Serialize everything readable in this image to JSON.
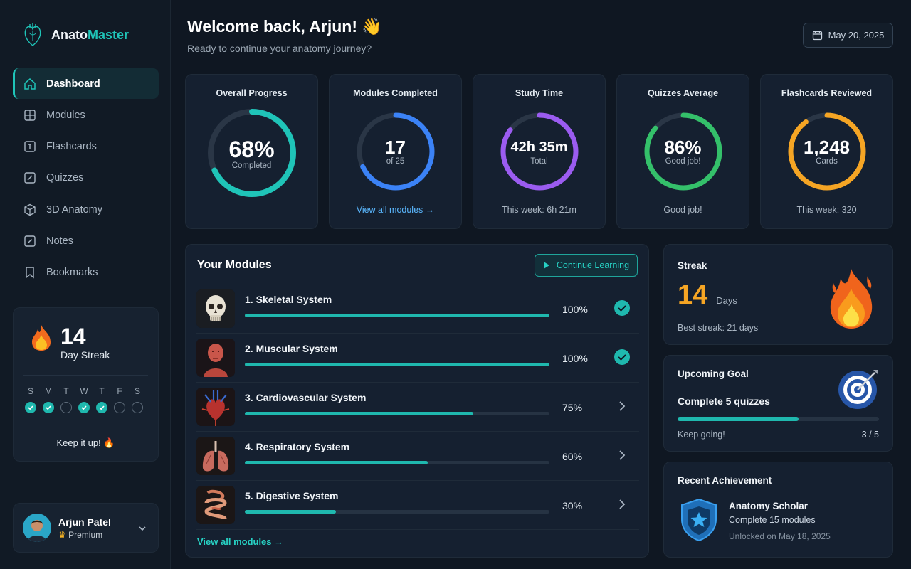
{
  "app": {
    "name_part1": "Anato",
    "name_part2": "Master"
  },
  "nav": [
    {
      "label": "Dashboard",
      "icon": "home-icon",
      "active": true
    },
    {
      "label": "Modules",
      "icon": "modules-icon"
    },
    {
      "label": "Flashcards",
      "icon": "flashcards-icon"
    },
    {
      "label": "Quizzes",
      "icon": "quizzes-icon"
    },
    {
      "label": "3D Anatomy",
      "icon": "cube-icon"
    },
    {
      "label": "Notes",
      "icon": "notes-icon"
    },
    {
      "label": "Bookmarks",
      "icon": "bookmark-icon"
    }
  ],
  "sidebar_streak": {
    "count": "14",
    "label": "Day Streak",
    "days": [
      {
        "letter": "S",
        "done": true
      },
      {
        "letter": "M",
        "done": true
      },
      {
        "letter": "T",
        "done": false
      },
      {
        "letter": "W",
        "done": true
      },
      {
        "letter": "T",
        "done": true
      },
      {
        "letter": "F",
        "done": false
      },
      {
        "letter": "S",
        "done": false
      }
    ],
    "message": "Keep it up! 🔥"
  },
  "user": {
    "name": "Arjun Patel",
    "tier": "Premium"
  },
  "header": {
    "welcome": "Welcome back, Arjun! 👋",
    "subtitle": "Ready to continue your anatomy journey?",
    "date": "May 20, 2025"
  },
  "stats": [
    {
      "title": "Overall Progress",
      "value": "68%",
      "sub": "Completed",
      "fraction": 0.68,
      "color": "#1fc4b8",
      "foot": ""
    },
    {
      "title": "Modules Completed",
      "value": "17",
      "sub": "of 25",
      "fraction": 0.68,
      "color": "#3b82f6",
      "foot": "View all modules →"
    },
    {
      "title": "Study Time",
      "value": "42h 35m",
      "sub": "Total",
      "fraction": 0.85,
      "color": "#9b5cf0",
      "foot": "This week: 6h 21m"
    },
    {
      "title": "Quizzes Average",
      "value": "86%",
      "sub": "Good job!",
      "fraction": 0.86,
      "color": "#34c06a",
      "foot": "Good job!"
    },
    {
      "title": "Flashcards Reviewed",
      "value": "1,248",
      "sub": "Cards",
      "fraction": 0.9,
      "color": "#f5a524",
      "foot": "This week: 320"
    }
  ],
  "modules": {
    "title": "Your Modules",
    "continue_label": "Continue Learning",
    "view_all": "View all modules →",
    "items": [
      {
        "name": "1. Skeletal System",
        "pct_label": "100%",
        "progress": 1.0,
        "complete": true,
        "thumb": "skull"
      },
      {
        "name": "2. Muscular System",
        "pct_label": "100%",
        "progress": 1.0,
        "complete": true,
        "thumb": "muscle"
      },
      {
        "name": "3. Cardiovascular System",
        "pct_label": "75%",
        "progress": 0.75,
        "complete": false,
        "thumb": "heart"
      },
      {
        "name": "4. Respiratory System",
        "pct_label": "60%",
        "progress": 0.6,
        "complete": false,
        "thumb": "lungs"
      },
      {
        "name": "5. Digestive System",
        "pct_label": "30%",
        "progress": 0.3,
        "complete": false,
        "thumb": "gut"
      }
    ]
  },
  "streak_card": {
    "title": "Streak",
    "count": "14",
    "unit": "Days",
    "best": "Best streak: 21 days"
  },
  "goal": {
    "title": "Upcoming Goal",
    "text": "Complete 5 quizzes",
    "note": "Keep going!",
    "count": "3 / 5",
    "progress": 0.6
  },
  "achievement": {
    "title": "Recent Achievement",
    "name": "Anatomy Scholar",
    "desc": "Complete 15 modules",
    "date": "Unlocked on May 18, 2025"
  }
}
